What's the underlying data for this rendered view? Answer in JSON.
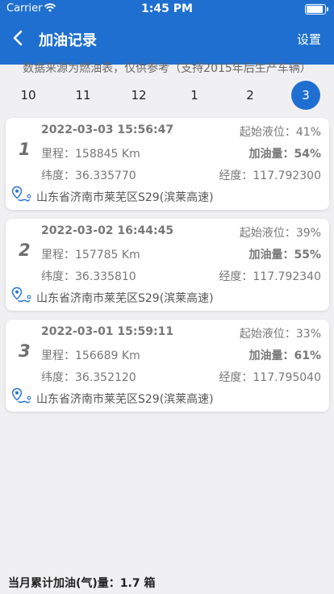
{
  "status_bar": {
    "carrier": "Carrier",
    "time": "1:45 PM",
    "battery_level": 1.0
  },
  "header": {
    "title": "加油记录",
    "settings_label": "设置"
  },
  "notice": "数据来源为燃油表，仅供参考（支持2015年后生产车辆）",
  "months": [
    "10",
    "11",
    "12",
    "1",
    "2",
    "3"
  ],
  "selected_month_index": 5,
  "records": [
    {
      "index": "1",
      "datetime": "2022-03-03 15:56:47",
      "start_level_label": "起始液位：",
      "start_level": "41%",
      "mileage_label": "里程：",
      "mileage": "158845 Km",
      "refuel_label": "加油量：",
      "refuel": "54%",
      "lat_label": "纬度：",
      "lat": "36.335770",
      "lon_label": "经度：",
      "lon": "117.792300",
      "address": "山东省济南市莱芜区S29(滨莱高速)"
    },
    {
      "index": "2",
      "datetime": "2022-03-02 16:44:45",
      "start_level_label": "起始液位：",
      "start_level": "39%",
      "mileage_label": "里程：",
      "mileage": "157785 Km",
      "refuel_label": "加油量：",
      "refuel": "55%",
      "lat_label": "纬度：",
      "lat": "36.335810",
      "lon_label": "经度：",
      "lon": "117.792340",
      "address": "山东省济南市莱芜区S29(滨莱高速)"
    },
    {
      "index": "3",
      "datetime": "2022-03-01 15:59:11",
      "start_level_label": "起始液位：",
      "start_level": "33%",
      "mileage_label": "里程：",
      "mileage": "156689 Km",
      "refuel_label": "加油量：",
      "refuel": "61%",
      "lat_label": "纬度：",
      "lat": "36.352120",
      "lon_label": "经度：",
      "lon": "117.795040",
      "address": "山东省济南市莱芜区S29(滨莱高速)"
    }
  ],
  "footer": {
    "summary": "当月累计加油(气)量：1.7 箱"
  },
  "colors": {
    "accent": "#1f6fd1",
    "background": "#f0f0f2"
  },
  "icons": {
    "back": "chevron-left-icon",
    "wifi": "wifi-icon",
    "battery": "battery-icon",
    "location": "location-pin-icon"
  }
}
